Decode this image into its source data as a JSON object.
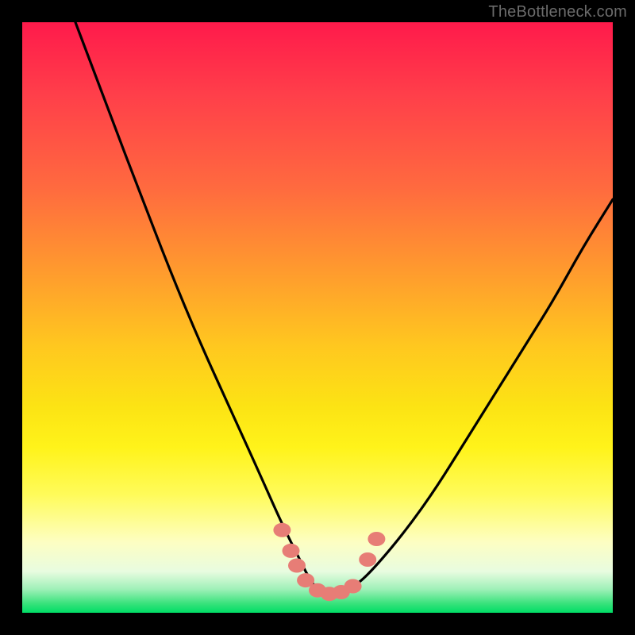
{
  "watermark": "TheBottleneck.com",
  "colors": {
    "frame": "#000000",
    "gradient_top": "#ff1a4b",
    "gradient_bottom": "#00dd66",
    "curve_stroke": "#000000",
    "marker_fill": "#e77d76",
    "marker_stroke": "#c9544f"
  },
  "chart_data": {
    "type": "line",
    "title": "",
    "xlabel": "",
    "ylabel": "",
    "xlim": [
      0,
      100
    ],
    "ylim": [
      0,
      100
    ],
    "grid": false,
    "legend": false,
    "description": "Vertical gradient background (red at y=100 through yellow at y≈40 to green at y=0) with a single black V-shaped curve whose minimum sits near x≈50, y≈3. Small coral markers cluster around the trough.",
    "series": [
      {
        "name": "curve",
        "x": [
          9,
          15,
          20,
          25,
          30,
          35,
          40,
          44,
          47,
          49,
          51,
          53,
          55,
          57,
          60,
          65,
          70,
          75,
          80,
          85,
          90,
          95,
          100
        ],
        "y": [
          100,
          84,
          71,
          58,
          46,
          35,
          24,
          15,
          9,
          5,
          3,
          3,
          4,
          5,
          8,
          14,
          21,
          29,
          37,
          45,
          53,
          62,
          70
        ]
      }
    ],
    "markers": {
      "name": "trough-points",
      "x": [
        44.0,
        45.5,
        46.5,
        48.0,
        50.0,
        52.0,
        54.0,
        56.0,
        58.5,
        60.0
      ],
      "y": [
        14.0,
        10.5,
        8.0,
        5.5,
        3.8,
        3.2,
        3.5,
        4.5,
        9.0,
        12.5
      ]
    }
  }
}
